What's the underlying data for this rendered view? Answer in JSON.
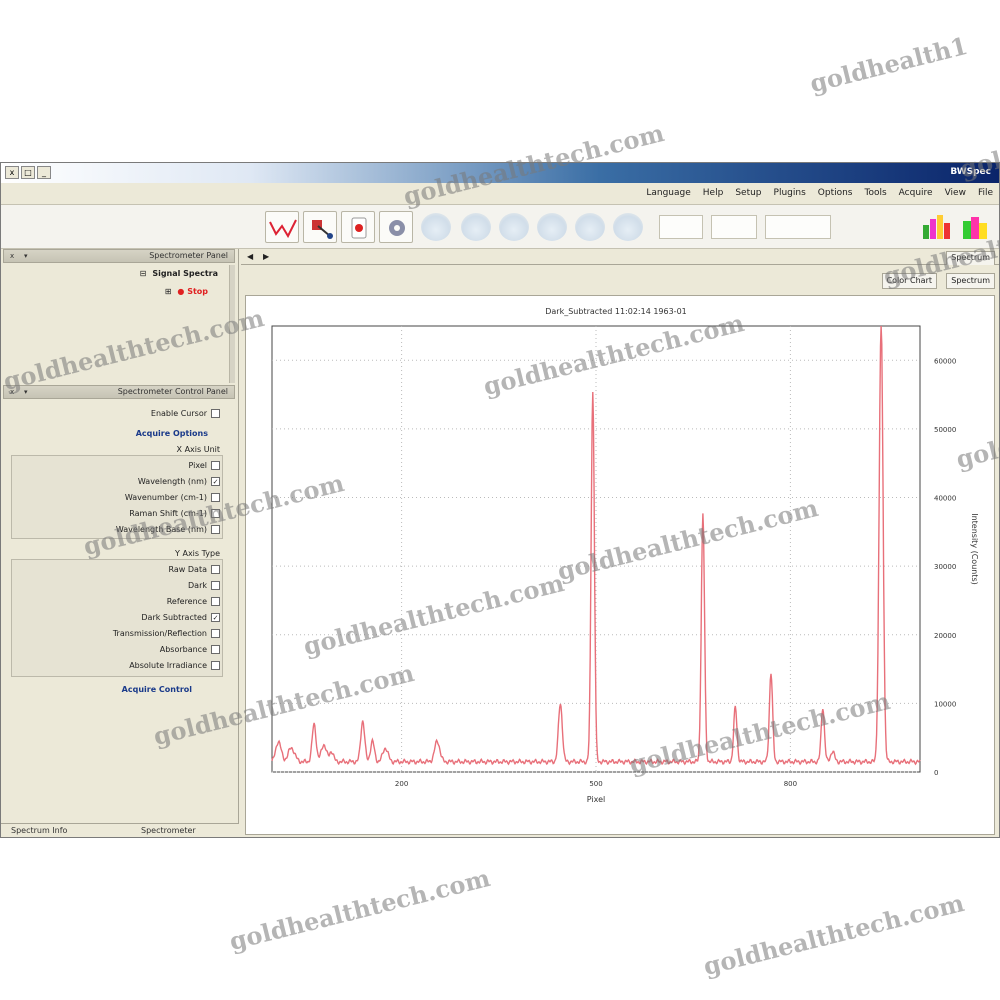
{
  "watermarks": [
    "goldhealth1",
    "goldhealthtech.com",
    "goldhealthtech.com",
    "goldhealthtech.com",
    "goldhealthtech.com",
    "goldhealthtech.com",
    "goldhealthtech.com",
    "goldhealthtech.com",
    "goldhealthtech.com",
    "goldhealthtech.com",
    "goldhealthtech.com",
    "goldhealthtech.com",
    "goldhealthtech.com",
    "goldhealthtech.com"
  ],
  "window": {
    "title": "BWSpec",
    "controls": [
      "x",
      "□",
      "_"
    ]
  },
  "menu": [
    "File",
    "View",
    "Acquire",
    "Tools",
    "Options",
    "Plugins",
    "Setup",
    "Help",
    "Language"
  ],
  "toolbar": {
    "inactive_count": 6
  },
  "panels": {
    "signal_panel": {
      "title": "Spectrometer Panel",
      "channel_label": "Signal Spectra",
      "live_label": "● Stop",
      "live_color": "#e02020"
    },
    "display_panel": {
      "title": "Spectrometer Control Panel",
      "enable_cursor": "Enable Cursor",
      "section_link": "Acquire Options",
      "units_heading": "X Axis Unit",
      "units": [
        {
          "label": "Pixel",
          "checked": false
        },
        {
          "label": "Wavelength (nm)",
          "checked": true
        },
        {
          "label": "Wavenumber (cm-1)",
          "checked": false
        },
        {
          "label": "Raman Shift (cm-1)",
          "checked": false
        },
        {
          "label": "Wavelength Base (nm)",
          "checked": false
        }
      ],
      "type_heading": "Y Axis Type",
      "types": [
        {
          "label": "Raw Data",
          "checked": false
        },
        {
          "label": "Dark",
          "checked": false
        },
        {
          "label": "Reference",
          "checked": false
        },
        {
          "label": "Dark Subtracted",
          "checked": true
        },
        {
          "label": "Transmission/Reflection",
          "checked": false
        },
        {
          "label": "Absorbance",
          "checked": false
        },
        {
          "label": "Absolute Irradiance",
          "checked": false
        }
      ],
      "bottom_link": "Acquire Control"
    }
  },
  "status_bar": [
    "Spectrometer",
    "Spectrum Info"
  ],
  "tabs": {
    "main": "Spectrum",
    "sub": [
      "Spectrum",
      "Color Chart"
    ]
  },
  "chart_data": {
    "type": "line",
    "title": "Dark_Subtracted   11:02:14  1963-01",
    "xlabel": "Pixel",
    "ylabel": "Intensity (Counts)",
    "series_color": "#e8707a",
    "xlim": [
      0,
      1000
    ],
    "ylim": [
      0,
      65000
    ],
    "xticks": [
      {
        "value": 200,
        "label": "200"
      },
      {
        "value": 500,
        "label": "500"
      },
      {
        "value": 800,
        "label": "800"
      }
    ],
    "yticks": [
      {
        "value": 0,
        "label": "0"
      },
      {
        "value": 10000,
        "label": "10000"
      },
      {
        "value": 20000,
        "label": "20000"
      },
      {
        "value": 30000,
        "label": "30000"
      },
      {
        "value": 40000,
        "label": "40000"
      },
      {
        "value": 50000,
        "label": "50000"
      },
      {
        "value": 60000,
        "label": "60000"
      }
    ],
    "baseline": 1500,
    "peaks": [
      {
        "x": 10,
        "height": 3000,
        "width": 4
      },
      {
        "x": 30,
        "height": 2000,
        "width": 5
      },
      {
        "x": 65,
        "height": 5500,
        "width": 3
      },
      {
        "x": 80,
        "height": 2500,
        "width": 4
      },
      {
        "x": 92,
        "height": 1500,
        "width": 3
      },
      {
        "x": 140,
        "height": 6000,
        "width": 3
      },
      {
        "x": 155,
        "height": 3000,
        "width": 3
      },
      {
        "x": 175,
        "height": 2000,
        "width": 4
      },
      {
        "x": 255,
        "height": 3000,
        "width": 4
      },
      {
        "x": 445,
        "height": 8500,
        "width": 3
      },
      {
        "x": 495,
        "height": 54000,
        "width": 2.5
      },
      {
        "x": 665,
        "height": 36000,
        "width": 2.5
      },
      {
        "x": 715,
        "height": 8000,
        "width": 2.5
      },
      {
        "x": 770,
        "height": 13000,
        "width": 2.5
      },
      {
        "x": 850,
        "height": 8000,
        "width": 2.5
      },
      {
        "x": 865,
        "height": 1500,
        "width": 3
      },
      {
        "x": 940,
        "height": 64000,
        "width": 3
      }
    ]
  }
}
